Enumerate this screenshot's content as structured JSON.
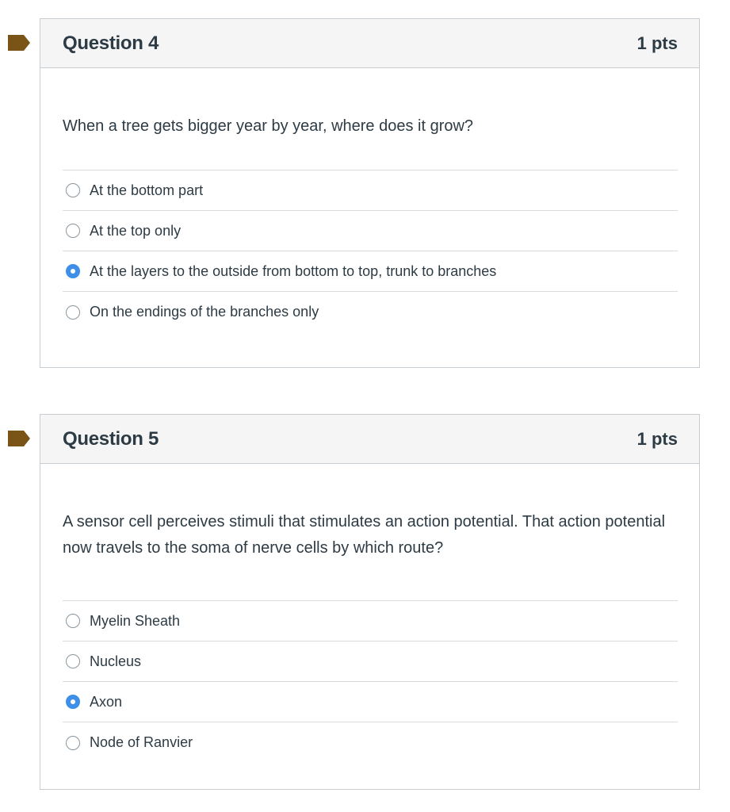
{
  "colors": {
    "flag": "#7a5416",
    "selected_radio": "#3d8fe8",
    "header_bg": "#f5f5f5",
    "border": "#c7cdd1",
    "text": "#2d3b45"
  },
  "questions": [
    {
      "title": "Question 4",
      "points": "1 pts",
      "text": "When a tree gets bigger year by year, where does it grow?",
      "flag_icon": "flag-icon",
      "answers": [
        {
          "label": "At the bottom part",
          "selected": false
        },
        {
          "label": "At the top only",
          "selected": false
        },
        {
          "label": "At the layers to the outside from bottom to top, trunk to branches",
          "selected": true
        },
        {
          "label": "On the endings of the branches only",
          "selected": false
        }
      ]
    },
    {
      "title": "Question 5",
      "points": "1 pts",
      "text": "A sensor cell perceives stimuli that stimulates an action potential. That action potential now travels to the soma of nerve cells by which route?",
      "flag_icon": "flag-icon",
      "answers": [
        {
          "label": "Myelin Sheath",
          "selected": false
        },
        {
          "label": "Nucleus",
          "selected": false
        },
        {
          "label": "Axon",
          "selected": true
        },
        {
          "label": "Node of Ranvier",
          "selected": false
        }
      ]
    }
  ]
}
